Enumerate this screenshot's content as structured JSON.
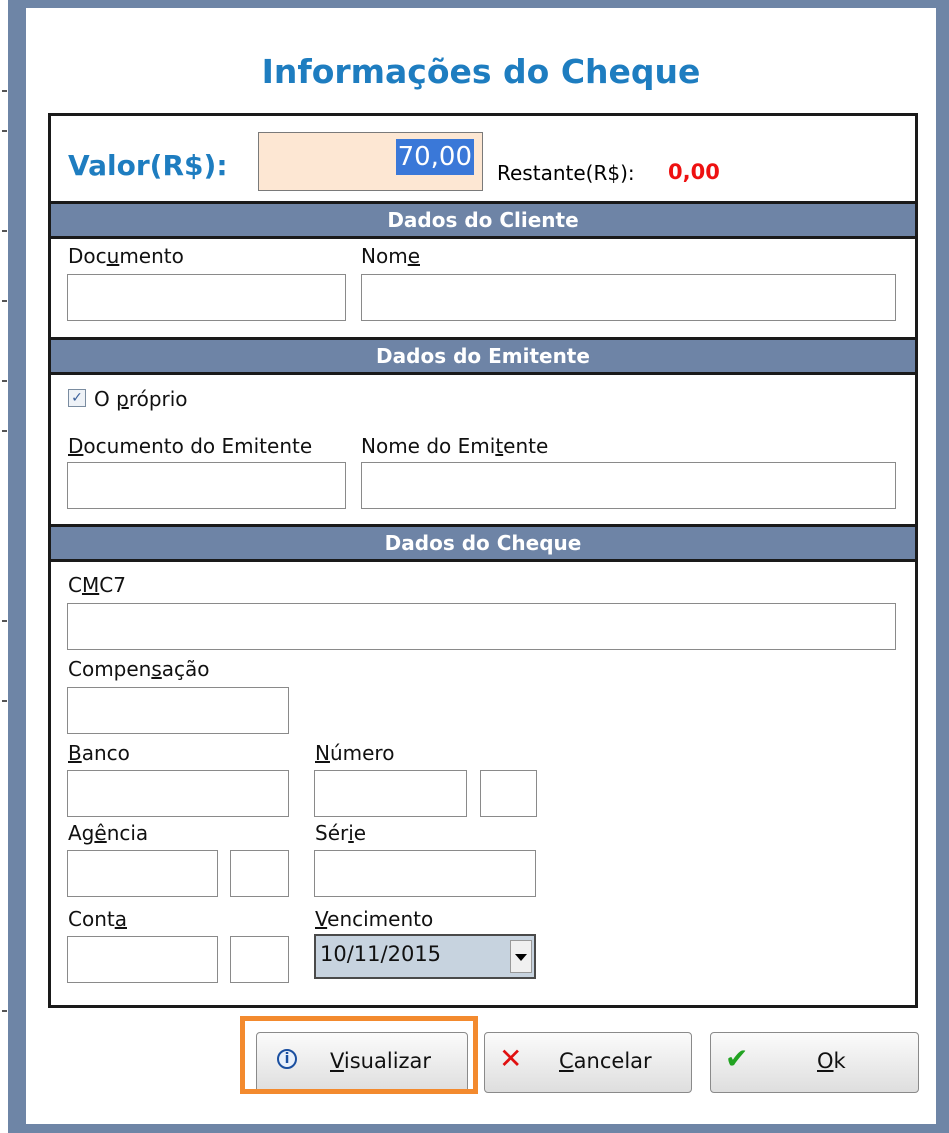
{
  "dialog": {
    "title": "Informações do Cheque"
  },
  "valor": {
    "label": "Valor(R$):",
    "value": "70,00",
    "restante_label": "Restante(R$):",
    "restante_value": "0,00"
  },
  "cliente": {
    "section_title": "Dados do Cliente",
    "documento_label": [
      "Doc",
      "u",
      "mento"
    ],
    "nome_label": [
      "Nom",
      "e",
      ""
    ]
  },
  "emitente": {
    "section_title": "Dados do Emitente",
    "checkbox_label": [
      "O ",
      "p",
      "róprio"
    ],
    "checkbox_checked": true,
    "documento_label": [
      "",
      "D",
      "ocumento do Emitente"
    ],
    "nome_label": [
      "Nome do Emi",
      "t",
      "ente"
    ]
  },
  "cheque": {
    "section_title": "Dados do Cheque",
    "cmc7_label": [
      "C",
      "M",
      "C7"
    ],
    "compensacao_label": [
      "Compen",
      "s",
      "ação"
    ],
    "banco_label": [
      "",
      "B",
      "anco"
    ],
    "numero_label": [
      "",
      "N",
      "úmero"
    ],
    "agencia_label": [
      "Ag",
      "ê",
      "ncia"
    ],
    "serie_label": [
      "Sér",
      "i",
      "e"
    ],
    "conta_label": [
      "Cont",
      "a",
      ""
    ],
    "vencimento_label": [
      "",
      "V",
      "encimento"
    ],
    "vencimento_value": "10/11/2015"
  },
  "buttons": {
    "visualizar": [
      "",
      "V",
      "isualizar"
    ],
    "cancelar": [
      "",
      "C",
      "ancelar"
    ],
    "ok": [
      "",
      "O",
      "k"
    ]
  },
  "colors": {
    "accent_blue": "#1e7dc0",
    "section_bar": "#6e84a6",
    "restante_red": "#ee1111",
    "valor_input_bg": "#fde7d3",
    "highlight_orange": "#f38a2e"
  },
  "icons": {
    "visualizar": "info-icon",
    "cancelar": "x-icon",
    "ok": "checkmark-icon",
    "vencimento": "chevron-down-icon"
  }
}
